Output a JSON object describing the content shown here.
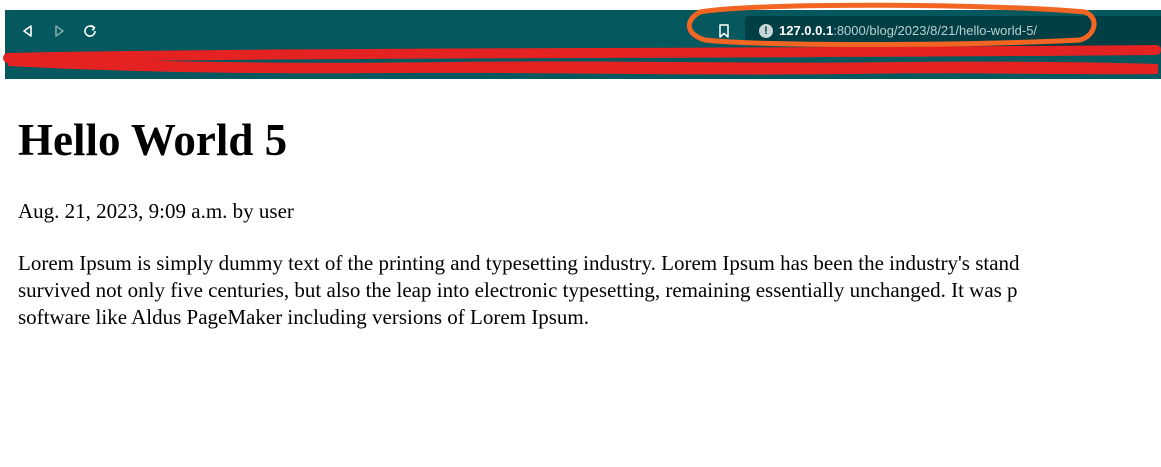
{
  "browser": {
    "url_host": "127.0.0.1",
    "url_path": ":8000/blog/2023/8/21/hello-world-5/",
    "info_icon": "info-icon",
    "chrome_color": "#04585e"
  },
  "post": {
    "title": "Hello World 5",
    "meta": "Aug. 21, 2023, 9:09 a.m. by user",
    "lines": [
      "Lorem Ipsum is simply dummy text of the printing and typesetting industry. Lorem Ipsum has been the industry's stand",
      "survived not only five centuries, but also the leap into electronic typesetting, remaining essentially unchanged. It was p",
      "software like Aldus PageMaker including versions of Lorem Ipsum."
    ]
  },
  "annotations": {
    "highlight_color": "#f26522",
    "redaction_color": "#e52222"
  }
}
